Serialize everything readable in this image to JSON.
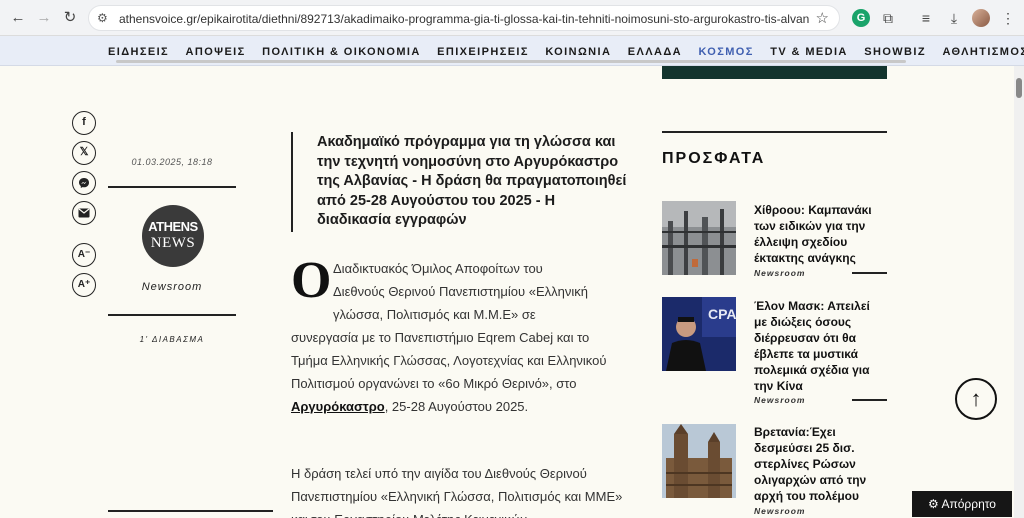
{
  "browser": {
    "site_info_icon": "tune-icon",
    "url": "athensvoice.gr/epikairotita/diethni/892713/akadimaiko-programma-gia-ti-glossa-kai-tin-tehniti-noimosuni-sto-argurokastro-tis-alvanias/?fbclid=I...",
    "grammarly_label": "G"
  },
  "nav": {
    "items": [
      {
        "label": "ΕΙΔΗΣΕΙΣ"
      },
      {
        "label": "ΑΠΟΨΕΙΣ"
      },
      {
        "label": "ΠΟΛΙΤΙΚΗ & ΟΙΚΟΝΟΜΙΑ"
      },
      {
        "label": "ΕΠΙΧΕΙΡΗΣΕΙΣ"
      },
      {
        "label": "ΚΟΙΝΩΝΙΑ"
      },
      {
        "label": "ΕΛΛΑΔΑ"
      },
      {
        "label": "ΚΟΣΜΟΣ"
      },
      {
        "label": "TV & MEDIA"
      },
      {
        "label": "SHOWBIZ"
      },
      {
        "label": "ΑΘΛΗΤΙΣΜΟΣ"
      }
    ],
    "active": "ΚΟΣΜΟΣ"
  },
  "article": {
    "date": "01.03.2025, 18:18",
    "logo_line1": "ATHENS",
    "logo_line2": "NEWS",
    "author": "Newsroom",
    "reading_time": "1' ΔΙΑΒΑΣΜΑ",
    "lede": "Ακαδημαϊκό πρόγραμμα για τη γλώσσα και την τεχνητή νοημοσύνη στο Αργυρόκαστρο της Αλβανίας - Η δράση θα πραγματοποιηθεί από 25-28 Αυγούστου του 2025 - Η διαδικασία εγγραφών",
    "dropcap": "Ο",
    "p1_line1": "Διαδικτυακός Όμιλος Αποφοίτων του",
    "p1_line2": "Διεθνούς Θερινού Πανεπιστημίου «Ελληνική",
    "p1_line3": "γλώσσα, Πολιτισμός και Μ.Μ.Ε» σε",
    "p1_rest": "συνεργασία με το Πανεπιστήμιο Eqrem Cabej και το Τμήμα Ελληνικής Γλώσσας, Λογοτεχνίας και Ελληνικού Πολιτισμού οργανώνει το «6ο Μικρό Θερινό», στο",
    "p1_link": "Αργυρόκαστρο",
    "p1_end": ", 25-28 Αυγούστου 2025.",
    "p2": "Η δράση τελεί υπό την αιγίδα του Διεθνούς Θερινού Πανεπιστημίου «Ελληνική Γλώσσα, Πολιτισμός και ΜΜΕ» και του Εργαστηρίου Μελέτης Κειμενικών"
  },
  "sidebar": {
    "title": "ΠΡΟΣΦΑΤΑ",
    "stories": [
      {
        "title": "Χίθροου: Καμπανάκι των ειδικών για την έλλειψη σχεδίου έκτακτης ανάγκης",
        "source": "Newsroom"
      },
      {
        "title": "Έλον Μασκ: Απειλεί με διώξεις όσους διέρρευσαν ότι θα έβλεπε τα μυστικά πολεμικά σχέδια για την Κίνα",
        "source": "Newsroom"
      },
      {
        "title": "Βρετανία:Έχει δεσμεύσει 25 δισ. στερλίνες Ρώσων ολιγαρχών από την αρχή του πολέμου",
        "source": "Newsroom"
      }
    ]
  },
  "share": {
    "facebook": "f",
    "x": "𝕏",
    "font_decrease": "A⁻",
    "font_increase": "A⁺"
  },
  "controls": {
    "back_to_top": "↑",
    "privacy": "Απόρρητο"
  }
}
